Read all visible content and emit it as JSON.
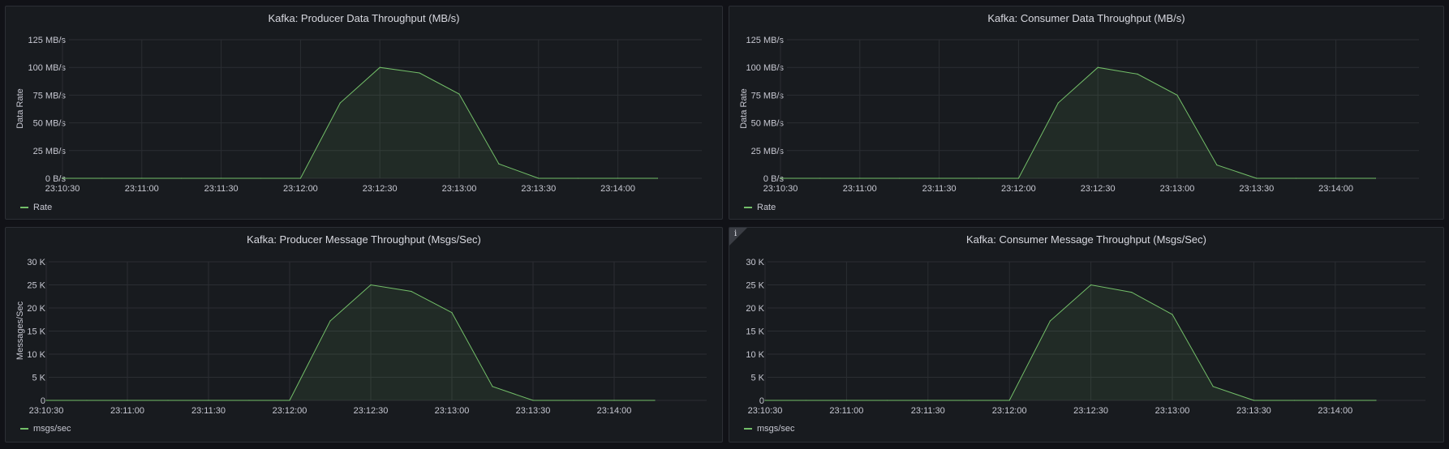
{
  "panels": [
    {
      "title": "Kafka: Producer Data Throughput (MB/s)",
      "legend": "Rate",
      "has_info": false
    },
    {
      "title": "Kafka: Consumer Data Throughput (MB/s)",
      "legend": "Rate",
      "has_info": false
    },
    {
      "title": "Kafka: Producer Message Throughput (Msgs/Sec)",
      "legend": "msgs/sec",
      "has_info": false
    },
    {
      "title": "Kafka: Consumer Message Throughput (Msgs/Sec)",
      "legend": "msgs/sec",
      "has_info": true,
      "info_icon": "i"
    }
  ],
  "colors": {
    "series": "#73bf69",
    "grid": "#2b2e33",
    "tick_text": "#c7c8d2"
  },
  "chart_data": [
    {
      "type": "area",
      "title": "Kafka: Producer Data Throughput (MB/s)",
      "xlabel": "",
      "ylabel": "Data Rate",
      "x": [
        "23:10:30",
        "23:10:45",
        "23:11:00",
        "23:11:15",
        "23:11:30",
        "23:11:45",
        "23:12:00",
        "23:12:15",
        "23:12:30",
        "23:12:45",
        "23:13:00",
        "23:13:15",
        "23:13:30",
        "23:13:45",
        "23:14:00",
        "23:14:15"
      ],
      "x_ticks": [
        "23:10:30",
        "23:11:00",
        "23:11:30",
        "23:12:00",
        "23:12:30",
        "23:13:00",
        "23:13:30",
        "23:14:00"
      ],
      "y_ticks": [
        "0 B/s",
        "25 MB/s",
        "50 MB/s",
        "75 MB/s",
        "100 MB/s",
        "125 MB/s"
      ],
      "ylim": [
        0,
        125
      ],
      "grid": true,
      "legend_position": "bottom-left",
      "series": [
        {
          "name": "Rate",
          "values": [
            0,
            0,
            0,
            0,
            0,
            0,
            0,
            68,
            100,
            95,
            76,
            13,
            0,
            0,
            0,
            0
          ]
        }
      ]
    },
    {
      "type": "area",
      "title": "Kafka: Consumer Data Throughput (MB/s)",
      "xlabel": "",
      "ylabel": "Data Rate",
      "x": [
        "23:10:30",
        "23:10:45",
        "23:11:00",
        "23:11:15",
        "23:11:30",
        "23:11:45",
        "23:12:00",
        "23:12:15",
        "23:12:30",
        "23:12:45",
        "23:13:00",
        "23:13:15",
        "23:13:30",
        "23:13:45",
        "23:14:00",
        "23:14:15"
      ],
      "x_ticks": [
        "23:10:30",
        "23:11:00",
        "23:11:30",
        "23:12:00",
        "23:12:30",
        "23:13:00",
        "23:13:30",
        "23:14:00"
      ],
      "y_ticks": [
        "0 B/s",
        "25 MB/s",
        "50 MB/s",
        "75 MB/s",
        "100 MB/s",
        "125 MB/s"
      ],
      "ylim": [
        0,
        125
      ],
      "grid": true,
      "legend_position": "bottom-left",
      "series": [
        {
          "name": "Rate",
          "values": [
            0,
            0,
            0,
            0,
            0,
            0,
            0,
            68,
            100,
            94,
            75,
            12,
            0,
            0,
            0,
            0
          ]
        }
      ]
    },
    {
      "type": "area",
      "title": "Kafka: Producer Message Throughput (Msgs/Sec)",
      "xlabel": "",
      "ylabel": "Messages/Sec",
      "x": [
        "23:10:30",
        "23:10:45",
        "23:11:00",
        "23:11:15",
        "23:11:30",
        "23:11:45",
        "23:12:00",
        "23:12:15",
        "23:12:30",
        "23:12:45",
        "23:13:00",
        "23:13:15",
        "23:13:30",
        "23:13:45",
        "23:14:00",
        "23:14:15"
      ],
      "x_ticks": [
        "23:10:30",
        "23:11:00",
        "23:11:30",
        "23:12:00",
        "23:12:30",
        "23:13:00",
        "23:13:30",
        "23:14:00"
      ],
      "y_ticks": [
        "0",
        "5 K",
        "10 K",
        "15 K",
        "20 K",
        "25 K",
        "30 K"
      ],
      "ylim": [
        0,
        30
      ],
      "grid": true,
      "legend_position": "bottom-left",
      "series": [
        {
          "name": "msgs/sec",
          "values": [
            0,
            0,
            0,
            0,
            0,
            0,
            0,
            17.2,
            25,
            23.6,
            19,
            3,
            0,
            0,
            0,
            0
          ]
        }
      ]
    },
    {
      "type": "area",
      "title": "Kafka: Consumer Message Throughput (Msgs/Sec)",
      "xlabel": "",
      "ylabel": "",
      "x": [
        "23:10:30",
        "23:10:45",
        "23:11:00",
        "23:11:15",
        "23:11:30",
        "23:11:45",
        "23:12:00",
        "23:12:15",
        "23:12:30",
        "23:12:45",
        "23:13:00",
        "23:13:15",
        "23:13:30",
        "23:13:45",
        "23:14:00",
        "23:14:15"
      ],
      "x_ticks": [
        "23:10:30",
        "23:11:00",
        "23:11:30",
        "23:12:00",
        "23:12:30",
        "23:13:00",
        "23:13:30",
        "23:14:00"
      ],
      "y_ticks": [
        "0",
        "5 K",
        "10 K",
        "15 K",
        "20 K",
        "25 K",
        "30 K"
      ],
      "ylim": [
        0,
        30
      ],
      "grid": true,
      "legend_position": "bottom-left",
      "series": [
        {
          "name": "msgs/sec",
          "values": [
            0,
            0,
            0,
            0,
            0,
            0,
            0,
            17.2,
            25,
            23.4,
            18.6,
            3,
            0,
            0,
            0,
            0
          ]
        }
      ]
    }
  ]
}
